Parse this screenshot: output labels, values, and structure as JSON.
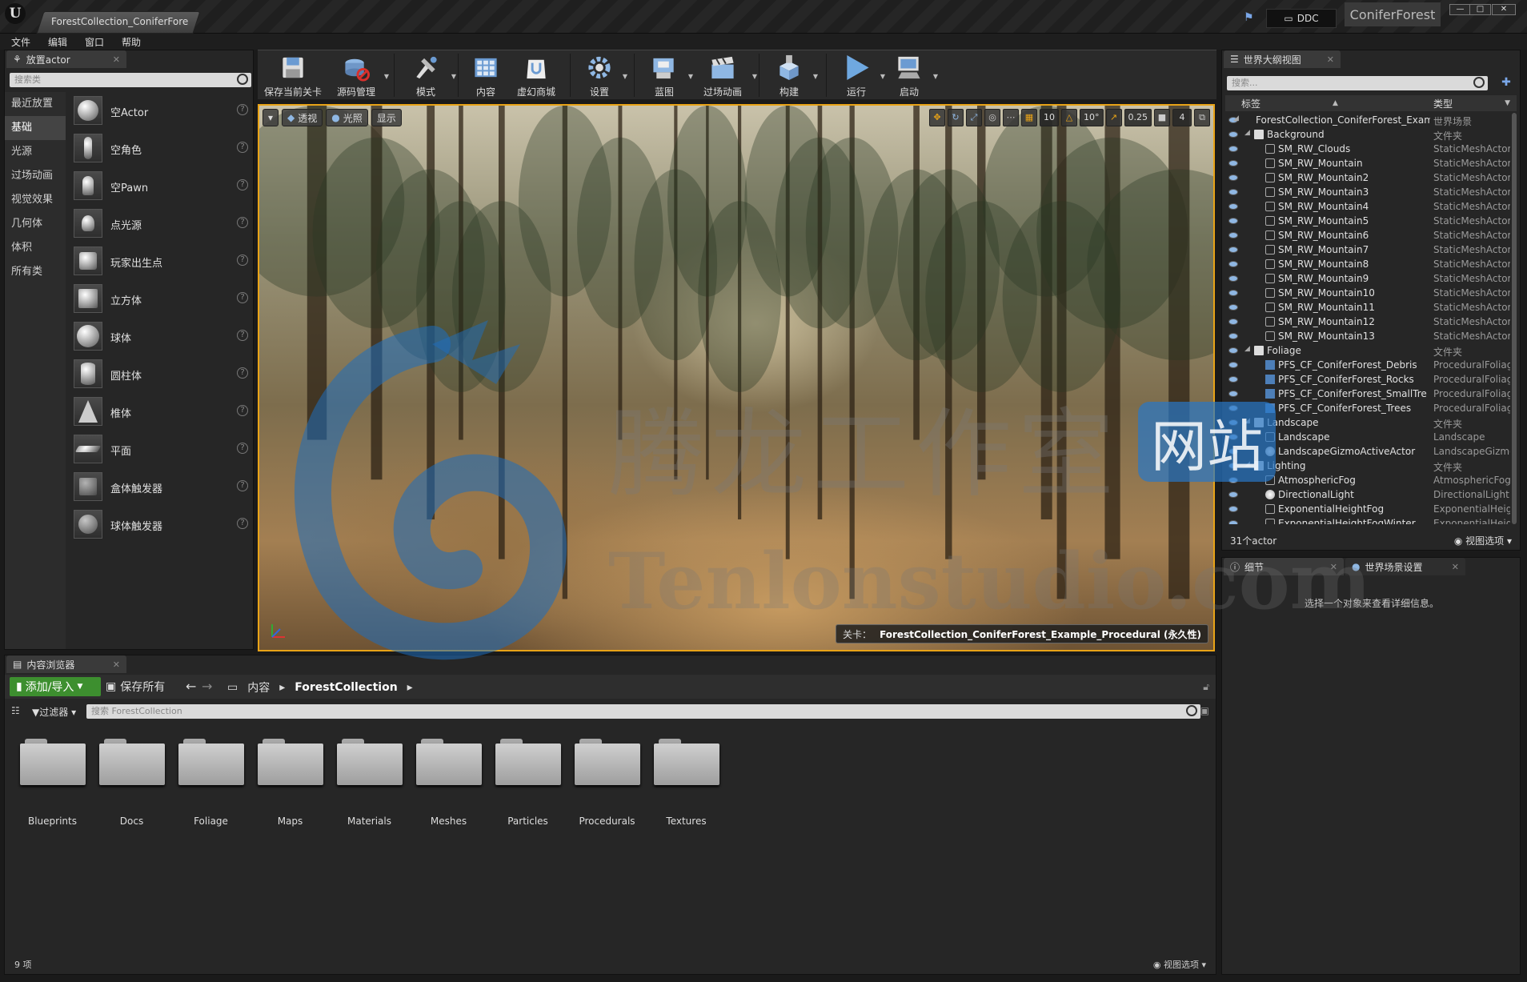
{
  "window": {
    "tab_title": "ForestCollection_ConiferFore",
    "ddc_label": "DDC",
    "project_name": "ConiferForest",
    "controls": {
      "minimize": "—",
      "maximize": "□",
      "close": "✕"
    }
  },
  "menu": [
    "文件",
    "编辑",
    "窗口",
    "帮助"
  ],
  "place_actors": {
    "tab": "放置actor",
    "search_placeholder": "搜索类",
    "categories": [
      "最近放置",
      "基础",
      "光源",
      "过场动画",
      "视觉效果",
      "几何体",
      "体积",
      "所有类"
    ],
    "active_category": "基础",
    "actors": [
      "空Actor",
      "空角色",
      "空Pawn",
      "点光源",
      "玩家出生点",
      "立方体",
      "球体",
      "圆柱体",
      "椎体",
      "平面",
      "盒体触发器",
      "球体触发器"
    ]
  },
  "toolbar": [
    {
      "label": "保存当前关卡",
      "icon": "save-icon"
    },
    {
      "label": "源码管理",
      "icon": "source-control-icon"
    },
    {
      "label": "模式",
      "icon": "modes-icon"
    },
    {
      "label": "内容",
      "icon": "content-icon"
    },
    {
      "label": "虚幻商城",
      "icon": "marketplace-icon"
    },
    {
      "label": "设置",
      "icon": "settings-icon"
    },
    {
      "label": "蓝图",
      "icon": "blueprint-icon"
    },
    {
      "label": "过场动画",
      "icon": "cinematics-icon"
    },
    {
      "label": "构建",
      "icon": "build-icon"
    },
    {
      "label": "运行",
      "icon": "play-icon"
    },
    {
      "label": "启动",
      "icon": "launch-icon"
    }
  ],
  "viewport": {
    "perspective": "透视",
    "lit": "光照",
    "show": "显示",
    "grid_snap": "10",
    "rotation_snap": "10°",
    "scale_snap": "0.25",
    "camera_speed": "4",
    "level_prefix": "关卡：",
    "level_name": "ForestCollection_ConiferForest_Example_Procedural (永久性)"
  },
  "watermark": {
    "cn": "腾龙工作室",
    "en": "Tenlonstudio.com",
    "site": "网站"
  },
  "outliner": {
    "tab": "世界大纲视图",
    "search_placeholder": "搜索...",
    "col_label": "标签",
    "col_type": "类型",
    "rows": [
      {
        "name": "ForestCollection_ConiferForest_Exam",
        "type": "世界场景",
        "indent": 0,
        "kind": "world",
        "arrow": "◢"
      },
      {
        "name": "Background",
        "type": "文件夹",
        "indent": 1,
        "kind": "folder",
        "arrow": "◢"
      },
      {
        "name": "SM_RW_Clouds",
        "type": "StaticMeshActor",
        "indent": 2,
        "kind": "mesh"
      },
      {
        "name": "SM_RW_Mountain",
        "type": "StaticMeshActor",
        "indent": 2,
        "kind": "mesh"
      },
      {
        "name": "SM_RW_Mountain2",
        "type": "StaticMeshActor",
        "indent": 2,
        "kind": "mesh"
      },
      {
        "name": "SM_RW_Mountain3",
        "type": "StaticMeshActor",
        "indent": 2,
        "kind": "mesh"
      },
      {
        "name": "SM_RW_Mountain4",
        "type": "StaticMeshActor",
        "indent": 2,
        "kind": "mesh"
      },
      {
        "name": "SM_RW_Mountain5",
        "type": "StaticMeshActor",
        "indent": 2,
        "kind": "mesh"
      },
      {
        "name": "SM_RW_Mountain6",
        "type": "StaticMeshActor",
        "indent": 2,
        "kind": "mesh"
      },
      {
        "name": "SM_RW_Mountain7",
        "type": "StaticMeshActor",
        "indent": 2,
        "kind": "mesh"
      },
      {
        "name": "SM_RW_Mountain8",
        "type": "StaticMeshActor",
        "indent": 2,
        "kind": "mesh"
      },
      {
        "name": "SM_RW_Mountain9",
        "type": "StaticMeshActor",
        "indent": 2,
        "kind": "mesh"
      },
      {
        "name": "SM_RW_Mountain10",
        "type": "StaticMeshActor",
        "indent": 2,
        "kind": "mesh"
      },
      {
        "name": "SM_RW_Mountain11",
        "type": "StaticMeshActor",
        "indent": 2,
        "kind": "mesh"
      },
      {
        "name": "SM_RW_Mountain12",
        "type": "StaticMeshActor",
        "indent": 2,
        "kind": "mesh"
      },
      {
        "name": "SM_RW_Mountain13",
        "type": "StaticMeshActor",
        "indent": 2,
        "kind": "mesh"
      },
      {
        "name": "Foliage",
        "type": "文件夹",
        "indent": 1,
        "kind": "folder",
        "arrow": "◢"
      },
      {
        "name": "PFS_CF_ConiferForest_Debris",
        "type": "ProceduralFoliage",
        "indent": 2,
        "kind": "foliage"
      },
      {
        "name": "PFS_CF_ConiferForest_Rocks",
        "type": "ProceduralFoliage",
        "indent": 2,
        "kind": "foliage"
      },
      {
        "name": "PFS_CF_ConiferForest_SmallTre",
        "type": "ProceduralFoliage",
        "indent": 2,
        "kind": "foliage"
      },
      {
        "name": "PFS_CF_ConiferForest_Trees",
        "type": "ProceduralFoliage",
        "indent": 2,
        "kind": "foliage"
      },
      {
        "name": "Landscape",
        "type": "文件夹",
        "indent": 1,
        "kind": "folder",
        "arrow": "◢"
      },
      {
        "name": "Landscape",
        "type": "Landscape",
        "indent": 2,
        "kind": "mesh"
      },
      {
        "name": "LandscapeGizmoActiveActor",
        "type": "LandscapeGizmo",
        "indent": 2,
        "kind": "light"
      },
      {
        "name": "Lighting",
        "type": "文件夹",
        "indent": 1,
        "kind": "folder",
        "arrow": "◢"
      },
      {
        "name": "AtmosphericFog",
        "type": "AtmosphericFog",
        "indent": 2,
        "kind": "mesh"
      },
      {
        "name": "DirectionalLight",
        "type": "DirectionalLight",
        "indent": 2,
        "kind": "light"
      },
      {
        "name": "ExponentialHeightFog",
        "type": "ExponentialHeigh",
        "indent": 2,
        "kind": "mesh"
      },
      {
        "name": "ExponentialHeightFogWinter",
        "type": "ExponentialHeigh",
        "indent": 2,
        "kind": "mesh"
      }
    ],
    "footer_count": "31个actor",
    "view_options": "视图选项"
  },
  "details": {
    "tab_details": "细节",
    "tab_world_settings": "世界场景设置",
    "empty_message": "选择一个对象来查看详细信息。"
  },
  "content_browser": {
    "tab": "内容浏览器",
    "add_import": "添加/导入",
    "save_all": "保存所有",
    "breadcrumb_root": "内容",
    "breadcrumb_current": "ForestCollection",
    "filter": "过滤器",
    "search_placeholder": "搜索 ForestCollection",
    "folders": [
      "Blueprints",
      "Docs",
      "Foliage",
      "Maps",
      "Materials",
      "Meshes",
      "Particles",
      "Procedurals",
      "Textures"
    ],
    "count": "9 项",
    "view_options": "视图选项"
  }
}
